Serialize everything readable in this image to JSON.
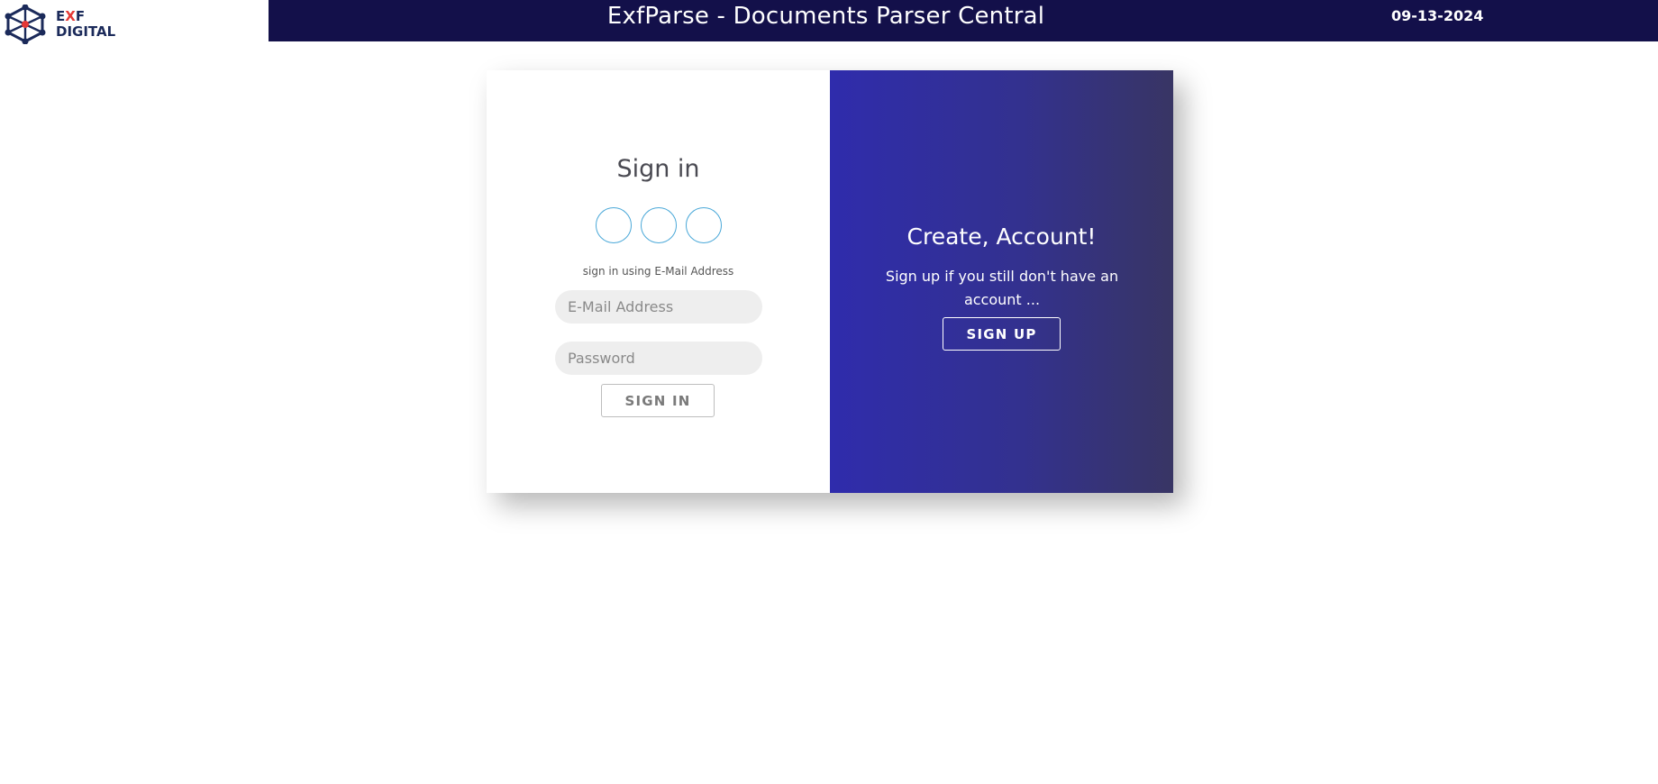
{
  "logo": {
    "line1_e": "E",
    "line1_x": "X",
    "line1_f": "F",
    "line2": "DIGITAL",
    "icon": "network-hexagon-icon",
    "colors": {
      "primary": "#1b2a5a",
      "accent": "#e53935"
    }
  },
  "header": {
    "title": "ExfParse - Documents Parser Central",
    "date": "09-13-2024",
    "background": "#13104a"
  },
  "signin": {
    "title": "Sign in",
    "social_icons": [
      "social-icon",
      "social-icon",
      "social-icon"
    ],
    "hint": "sign in using E-Mail Address",
    "email_placeholder": "E-Mail Address",
    "email_value": "",
    "password_placeholder": "Password",
    "password_value": "",
    "button_label": "SIGN IN"
  },
  "signup": {
    "title": "Create, Account!",
    "text": "Sign up if you still don't have an account ...",
    "button_label": "SIGN UP",
    "gradient": [
      "#2f2cac",
      "#383564"
    ]
  }
}
